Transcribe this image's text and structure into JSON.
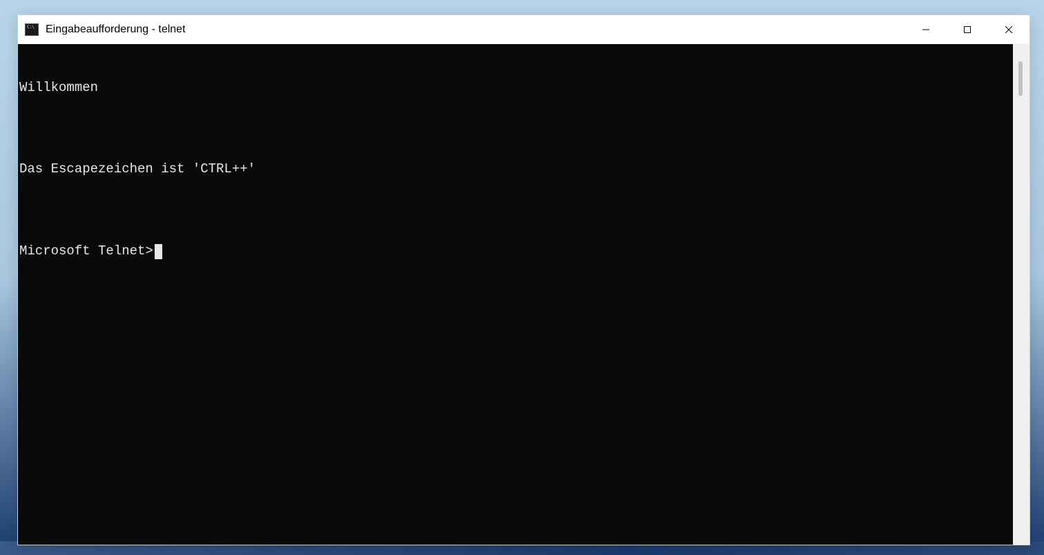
{
  "window": {
    "title": "Eingabeaufforderung - telnet"
  },
  "terminal": {
    "lines": [
      "Willkommen",
      "",
      "Das Escapezeichen ist 'CTRL++'",
      "",
      "Microsoft Telnet>"
    ]
  }
}
